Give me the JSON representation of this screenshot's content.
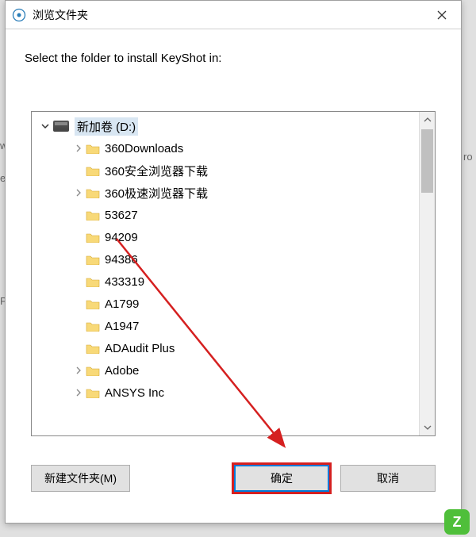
{
  "title": "浏览文件夹",
  "instruction": "Select the folder to install KeyShot    in:",
  "drive": {
    "label": "新加卷 (D:)"
  },
  "folders": [
    {
      "label": "360Downloads",
      "expandable": true
    },
    {
      "label": "360安全浏览器下载",
      "expandable": false
    },
    {
      "label": "360极速浏览器下载",
      "expandable": true
    },
    {
      "label": "53627",
      "expandable": false
    },
    {
      "label": "94209",
      "expandable": false
    },
    {
      "label": "94386",
      "expandable": false
    },
    {
      "label": "433319",
      "expandable": false
    },
    {
      "label": "A1799",
      "expandable": false
    },
    {
      "label": "A1947",
      "expandable": false
    },
    {
      "label": "ADAudit Plus",
      "expandable": false
    },
    {
      "label": "Adobe",
      "expandable": true
    },
    {
      "label": "ANSYS Inc",
      "expandable": true
    }
  ],
  "buttons": {
    "new_folder": "新建文件夹(M)",
    "ok": "确定",
    "cancel": "取消"
  },
  "watermark": {
    "badge": "Z",
    "text": ""
  },
  "sliver": {
    "w": "w",
    "e": "e",
    "p": "P",
    "ro": "ro"
  }
}
